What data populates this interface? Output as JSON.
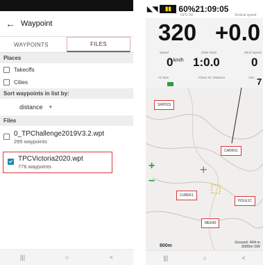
{
  "left": {
    "title": "Waypoint",
    "tabs": [
      "WAYPOINTS",
      "FILES"
    ],
    "places_header": "Places",
    "places": [
      "Takeoffs",
      "Cities"
    ],
    "sort_header": "Sort waypoints in list by:",
    "sort_value": "distance",
    "files_header": "Files",
    "files": [
      {
        "name": "0_TPChallenge2019V3.2.wpt",
        "count": "295 waypoints",
        "checked": false
      },
      {
        "name": "TPCVictoria2020.wpt",
        "count": "776 waypoints",
        "checked": true
      }
    ],
    "nav": [
      "|||",
      "○",
      "<"
    ]
  },
  "right": {
    "status": {
      "battery": "60%",
      "time": "21:09:05"
    },
    "gps_label": "GPS 3D",
    "vertical_label": "Vertical speed",
    "altitude": "320",
    "vario": "+0.0",
    "fields": [
      {
        "label": "Speed",
        "value": "0",
        "unit": "km/h"
      },
      {
        "label": "Glide Ratio",
        "value": "1:0.0"
      },
      {
        "label": "Wind Speed",
        "value": "0"
      }
    ],
    "labels2": [
      "Air time",
      "Flown XC Distance",
      "AGL"
    ],
    "agl_value": "7",
    "waypoints": [
      "SRP02S",
      "CARR31",
      "CUBEK1",
      "HOLE1C",
      "MEK40"
    ],
    "scale": "800m",
    "ground": [
      "Ground: 404 m",
      "3000m SW"
    ],
    "nav": [
      "|||",
      "○",
      "<"
    ]
  }
}
